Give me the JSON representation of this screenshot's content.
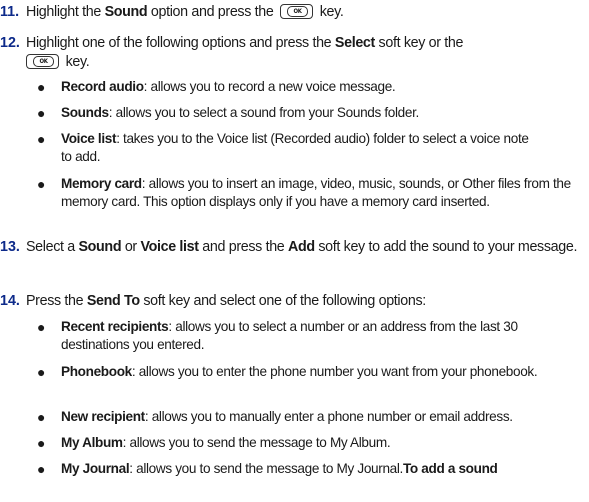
{
  "key_icon_label": "OK",
  "steps": [
    {
      "num": "11.",
      "t1": "Highlight the ",
      "b1": "Sound",
      "t2": " option and press the ",
      "t3": " key."
    },
    {
      "num": "12.",
      "t1": "Highlight one of the following options and press the ",
      "b1": "Select",
      "t2": " soft key or the",
      "t3": " key.",
      "bullets": [
        {
          "term": "Record audio",
          "desc": ": allows you to record a new voice message."
        },
        {
          "term": "Sounds",
          "desc": ": allows you to select a sound from your Sounds folder."
        },
        {
          "term": "Voice list",
          "desc": ": takes you to the Voice list (Recorded audio) folder to select a voice note to add."
        },
        {
          "term": "Memory card",
          "desc": ": allows you to insert an image, video, music, sounds, or Other files from the memory card. This option displays only if you have a memory card inserted."
        }
      ]
    },
    {
      "num": "13.",
      "t1": "Select a ",
      "b1": "Sound",
      "t2": " or ",
      "b2": "Voice list",
      "t3": " and press the ",
      "b3": "Add",
      "t4": " soft key to add the sound to your message."
    },
    {
      "num": "14.",
      "t1": "Press the ",
      "b1": "Send To",
      "t2": " soft key and select one of the following options:",
      "bullets": [
        {
          "term": "Recent recipients",
          "desc": ": allows you to select a number or an address from the last 30 destinations you entered."
        },
        {
          "term": "Phonebook",
          "desc": ": allows you to enter the phone number you want from your phonebook."
        },
        {
          "term": "New recipient",
          "desc": ": allows you to manually enter a phone number or email address."
        },
        {
          "term": "My Album",
          "desc": ": allows you to send the message to My Album."
        },
        {
          "term": "My Journal",
          "desc": ": allows you to send the message to My Journal.",
          "trail": "To add a sound"
        }
      ]
    }
  ]
}
